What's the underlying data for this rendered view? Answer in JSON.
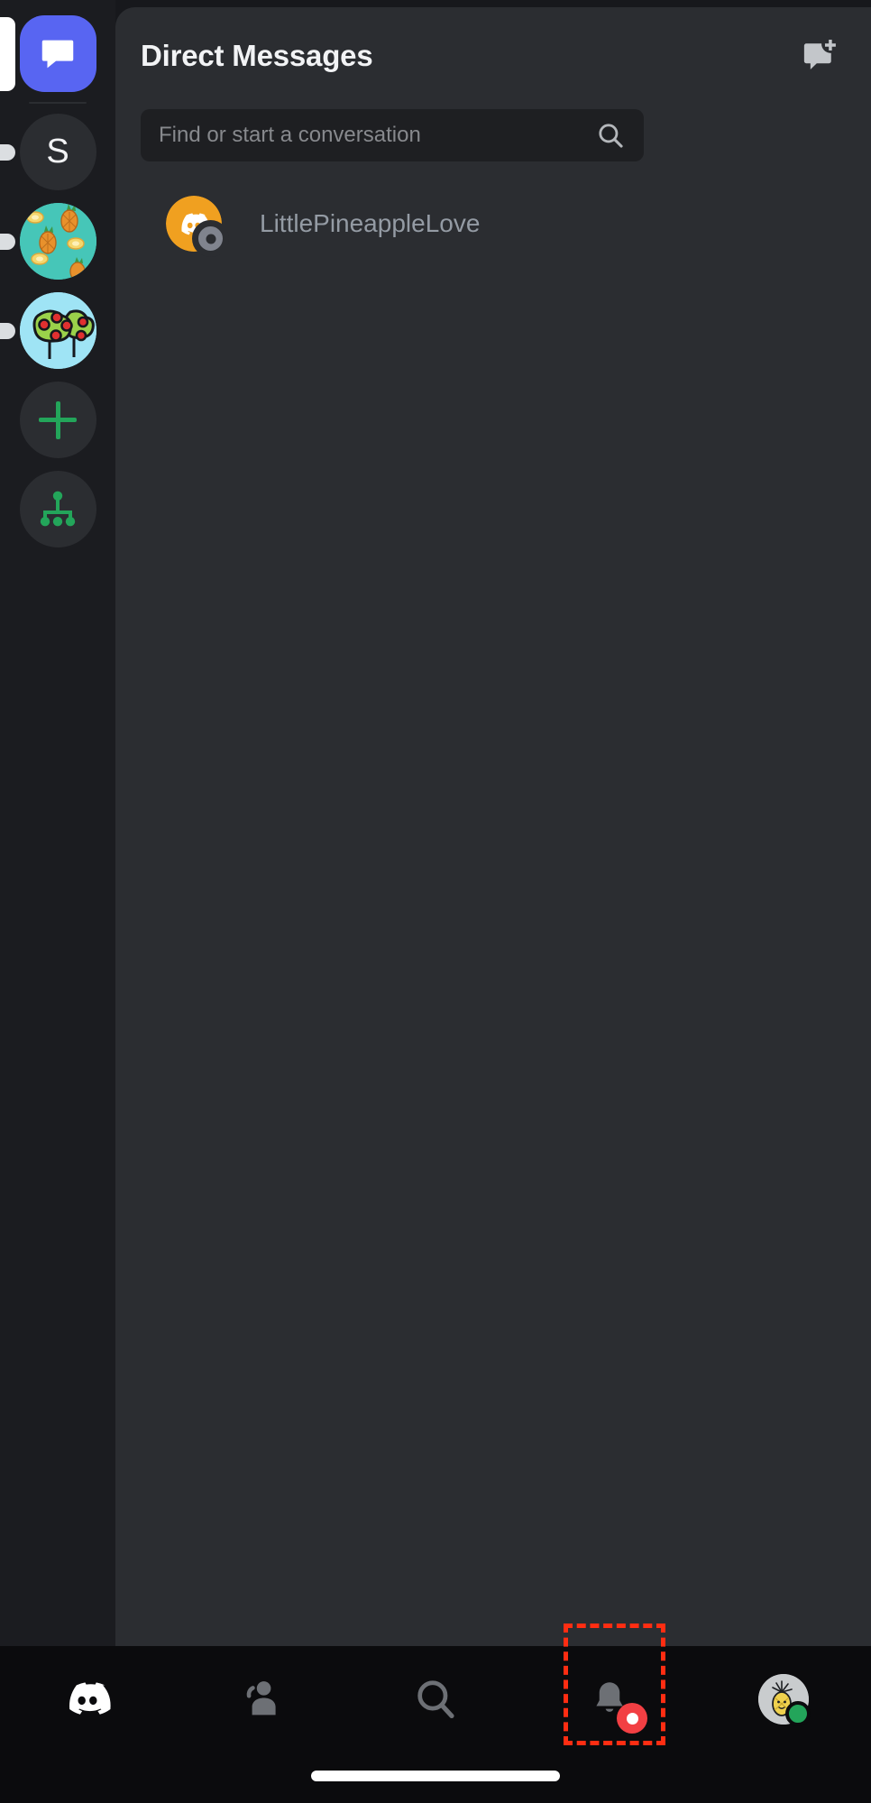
{
  "app": {
    "name": "Discord",
    "theme_bg": "#17181c",
    "panel_bg": "#2b2d31",
    "accent": "#5865f2",
    "online_color": "#23a55a",
    "badge_color": "#f23f43",
    "highlight_color": "#ff2d12"
  },
  "server_rail": {
    "items": [
      {
        "id": "home",
        "label": "Direct Messages",
        "icon": "chat-bubble-icon",
        "kind": "home",
        "selected": true,
        "unread": false
      },
      {
        "id": "server-s",
        "label": "S",
        "icon": "letter-avatar",
        "kind": "letter",
        "selected": false,
        "unread": true
      },
      {
        "id": "server-pine",
        "label": "Pineapple Server",
        "icon": "pineapple-pattern-icon",
        "kind": "image",
        "selected": false,
        "unread": true
      },
      {
        "id": "server-apple",
        "label": "Apple Tree Server",
        "icon": "apple-tree-icon",
        "kind": "image",
        "selected": false,
        "unread": true
      },
      {
        "id": "add-server",
        "label": "Add a Server",
        "icon": "plus-icon",
        "kind": "action",
        "selected": false,
        "unread": false
      },
      {
        "id": "explore",
        "label": "Explore Public Servers",
        "icon": "network-hierarchy-icon",
        "kind": "action",
        "selected": false,
        "unread": false
      }
    ]
  },
  "header": {
    "title": "Direct Messages",
    "new_dm_icon": "new-message-icon"
  },
  "search": {
    "placeholder": "Find or start a conversation",
    "value": "",
    "icon": "search-icon"
  },
  "dm_list": {
    "items": [
      {
        "name": "LittlePineappleLove",
        "avatar": "discord-default-orange",
        "status": "offline"
      }
    ]
  },
  "bottom_nav": {
    "items": [
      {
        "id": "servers",
        "label": "Servers",
        "icon": "discord-logo-icon",
        "active": true,
        "badge": null
      },
      {
        "id": "friends",
        "label": "Friends",
        "icon": "person-wave-icon",
        "active": false,
        "badge": null
      },
      {
        "id": "search",
        "label": "Search",
        "icon": "search-icon",
        "active": false,
        "badge": null
      },
      {
        "id": "notifications",
        "label": "Notifications",
        "icon": "bell-icon",
        "active": false,
        "badge": "dot"
      },
      {
        "id": "profile",
        "label": "You",
        "icon": "user-avatar-pineapple",
        "active": false,
        "badge": null,
        "presence": "online",
        "highlighted": true
      }
    ]
  }
}
